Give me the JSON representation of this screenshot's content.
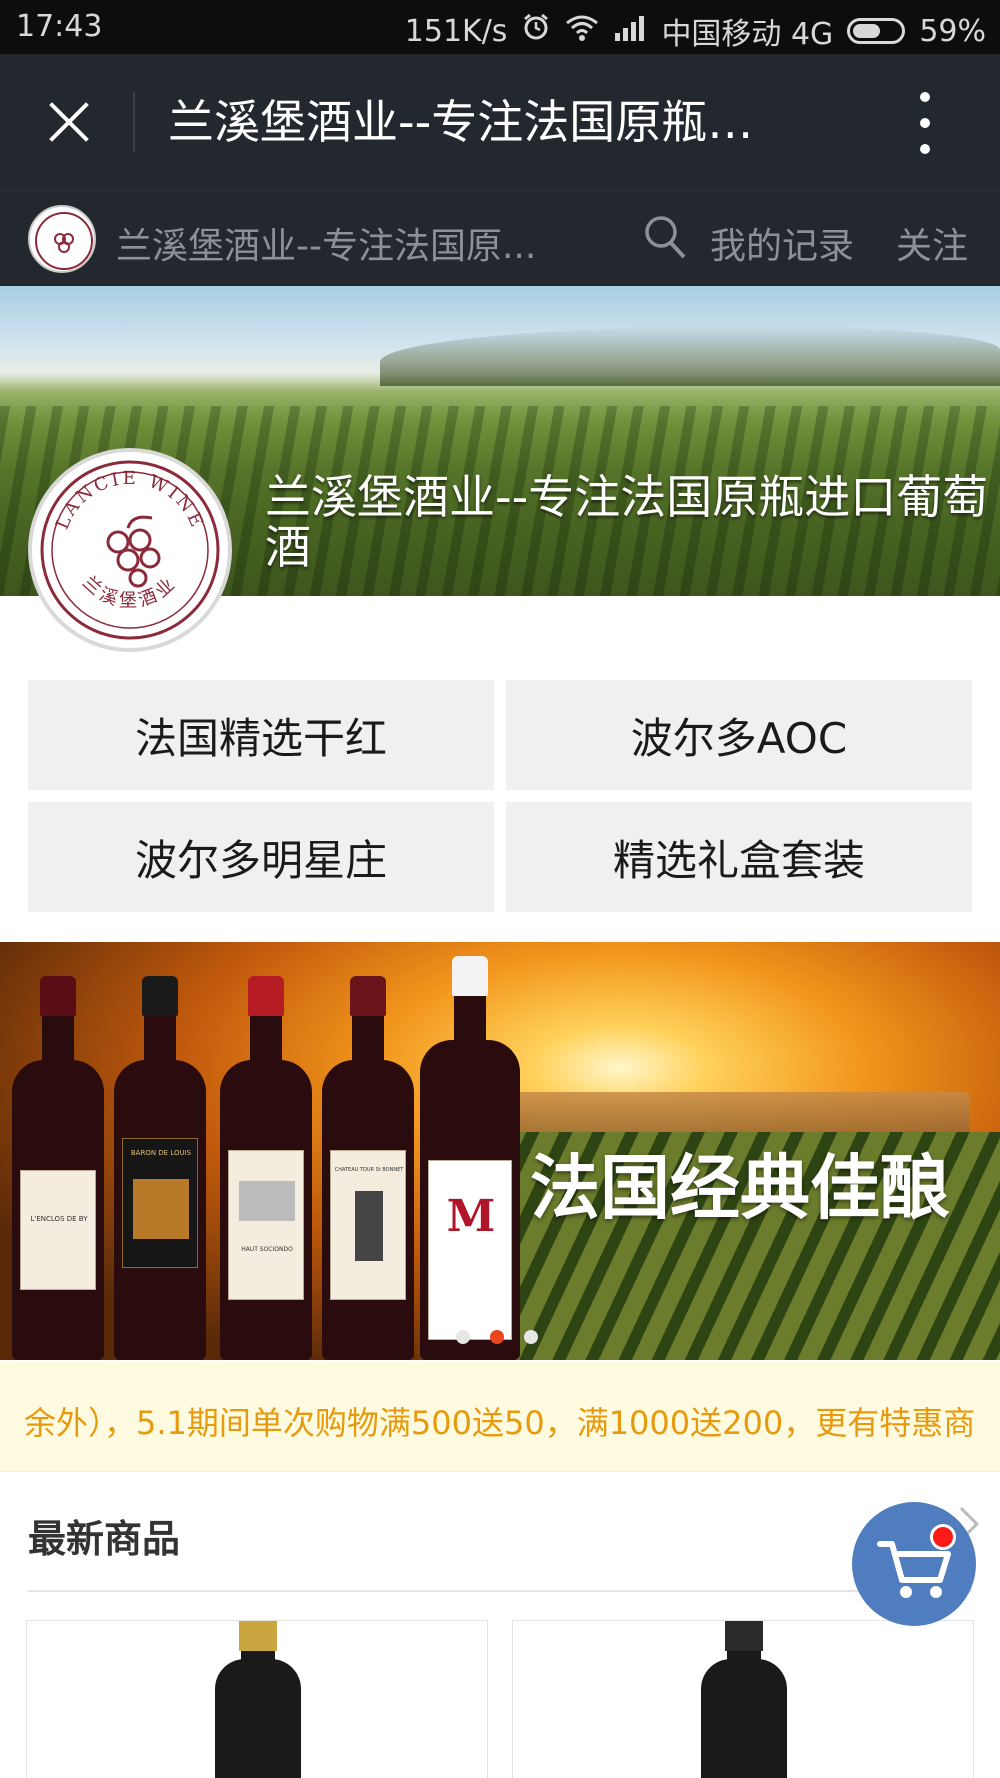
{
  "status_bar": {
    "time": "17:43",
    "net_speed": "151K/s",
    "carrier": "中国移动 4G",
    "battery": "59%",
    "battery_level": 0.59
  },
  "title_bar": {
    "title": "兰溪堡酒业--专注法国原瓶…",
    "close_icon": "close-icon",
    "more_icon": "more-vertical-icon"
  },
  "account_bar": {
    "name": "兰溪堡酒业--专注法国原...",
    "search_icon": "search-icon",
    "records": "我的记录",
    "follow": "关注"
  },
  "hero": {
    "title": "兰溪堡酒业--专注法国原瓶进口葡萄酒",
    "logo_text_top": "LANCIE WINE",
    "logo_text_bottom": "兰溪堡酒业",
    "logo_color": "#8a2a3a"
  },
  "categories": [
    {
      "label": "法国精选干红"
    },
    {
      "label": "波尔多AOC"
    },
    {
      "label": "波尔多明星庄"
    },
    {
      "label": "精选礼盒套装"
    }
  ],
  "banner": {
    "text": "法国经典佳酿",
    "bottle_labels": [
      "L'ENCLOS DE BY",
      "BARON DE LOUIS",
      "HAUT SOCIONDO",
      "CHATEAU TOUR St BONNET",
      "M"
    ],
    "slides_total": 3,
    "active_slide": 2
  },
  "notice": {
    "text": "余外），5.1期间单次购物满500送50，满1000送200，更有特惠商"
  },
  "latest": {
    "title": "最新商品"
  },
  "cart": {
    "icon": "cart-icon",
    "badge_color": "#ff1a1a",
    "button_color": "#4f7dbf"
  },
  "colors": {
    "header_bg": "#23272e",
    "notice_text": "#e69a0e",
    "notice_bg": "#fffbe0",
    "active_dot": "#e8461c"
  }
}
